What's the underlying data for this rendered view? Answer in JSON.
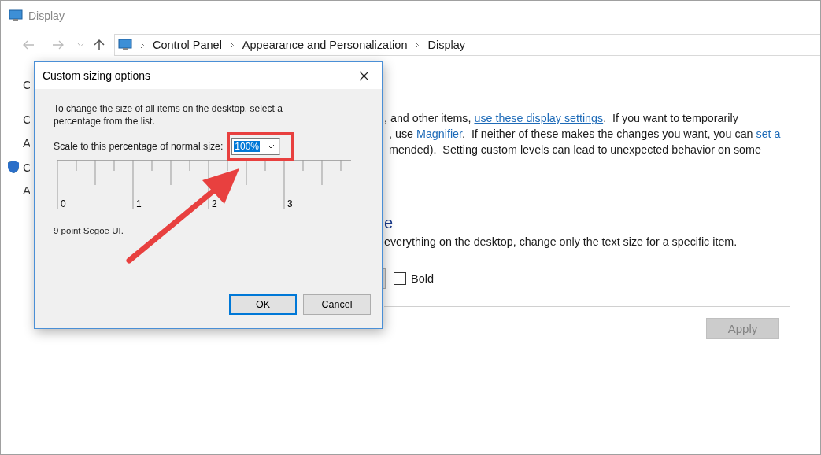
{
  "window": {
    "title": "Display"
  },
  "address_bar": {
    "path": [
      "Control Panel",
      "Appearance and Personalization",
      "Display"
    ]
  },
  "sidebar": {
    "items": [
      {
        "label": "C",
        "kind": "text"
      },
      {
        "label": "C",
        "kind": "text"
      },
      {
        "label": "A",
        "kind": "text"
      },
      {
        "label": "C",
        "kind": "shield"
      },
      {
        "label": "A",
        "kind": "text"
      }
    ]
  },
  "content": {
    "lines": [
      [
        {
          "text": ", and other items, ",
          "kind": "text"
        },
        {
          "text": "use these display settings",
          "kind": "link"
        },
        {
          "text": ".  If you want to temporarily",
          "kind": "text"
        }
      ],
      [
        {
          "text": ", use ",
          "kind": "text"
        },
        {
          "text": "Magnifier",
          "kind": "link"
        },
        {
          "text": ".  If neither of these makes the changes you want, you can ",
          "kind": "text"
        },
        {
          "text": "set a",
          "kind": "link"
        }
      ],
      [
        {
          "text": "mended).  Setting custom levels can lead to unexpected behavior on some",
          "kind": "text"
        }
      ]
    ],
    "heading": "e",
    "description": "everything on the desktop, change only the text size for a specific item.",
    "bold_checkbox": {
      "label": "Bold",
      "checked": false
    },
    "apply_button": {
      "label": "Apply",
      "disabled": true
    }
  },
  "dialog": {
    "title": "Custom sizing options",
    "instruction": "To change the size of all items on the desktop, select a percentage from the list.",
    "scale_label": "Scale to this percentage of normal size:",
    "scale_value": "100%",
    "ruler_labels": [
      "0",
      "1",
      "2",
      "3"
    ],
    "sample_text": "9 point Segoe UI.",
    "buttons": [
      {
        "label": "OK",
        "default": true
      },
      {
        "label": "Cancel",
        "default": false
      }
    ]
  }
}
